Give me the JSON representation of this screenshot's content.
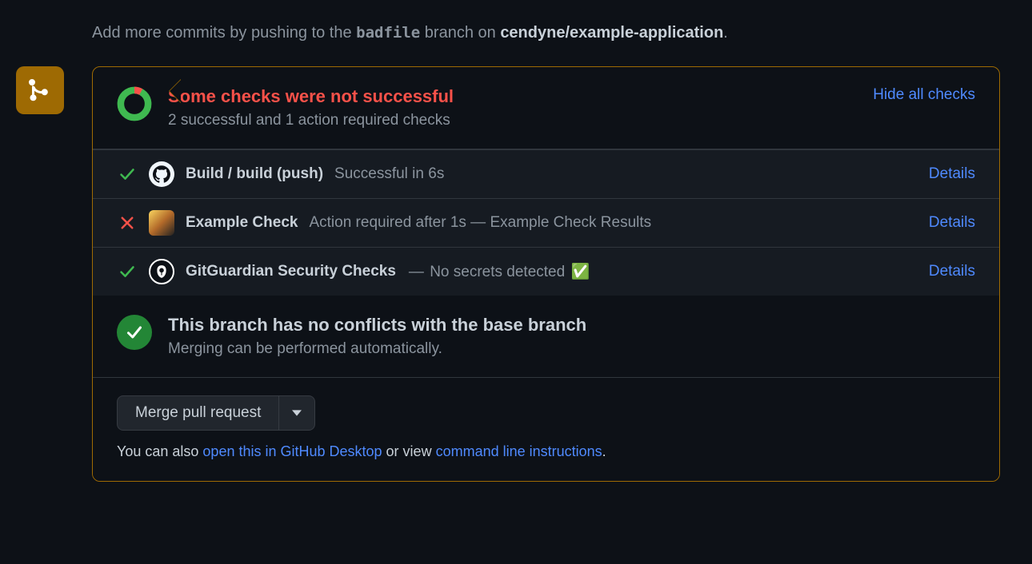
{
  "hint": {
    "prefix": "Add more commits by pushing to the ",
    "branch": "badfile",
    "mid": " branch on ",
    "repo": "cendyne/example-application",
    "suffix": "."
  },
  "checks_header": {
    "title": "Some checks were not successful",
    "subtitle": "2 successful and 1 action required checks",
    "toggle": "Hide all checks"
  },
  "checks": [
    {
      "status": "success",
      "avatar": "gh",
      "name": "Build / build (push)",
      "meta_plain": "Successful in 6s",
      "details": "Details"
    },
    {
      "status": "fail",
      "avatar": "ex",
      "name": "Example Check",
      "meta_plain": "Action required after 1s — Example Check Results",
      "details": "Details"
    },
    {
      "status": "success",
      "avatar": "gg",
      "name": "GitGuardian Security Checks",
      "meta_dash": "—",
      "meta_after": "No secrets detected",
      "meta_emoji": "✅",
      "details": "Details"
    }
  ],
  "conflict": {
    "title": "This branch has no conflicts with the base branch",
    "subtitle": "Merging can be performed automatically."
  },
  "footer": {
    "merge_button": "Merge pull request",
    "hint_prefix": "You can also ",
    "link_desktop": "open this in GitHub Desktop",
    "hint_mid": " or view ",
    "link_cli": "command line instructions",
    "hint_suffix": "."
  }
}
